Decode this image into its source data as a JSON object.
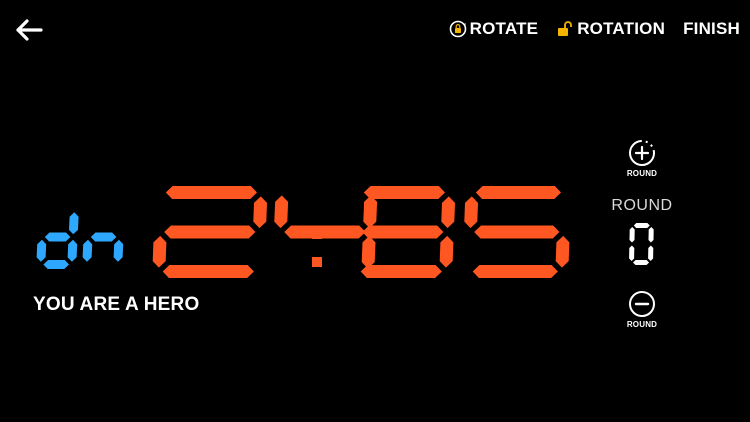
{
  "header": {
    "back_icon": "arrow-left-icon",
    "actions": [
      {
        "label": "ROTATE",
        "icon": "rotate-lock-icon"
      },
      {
        "label": "ROTATION",
        "icon": "unlock-icon"
      },
      {
        "label": "FINISH"
      }
    ],
    "icon_accent": "#f5b400"
  },
  "timer": {
    "direction": "dn",
    "minutes": "24",
    "seconds": "35",
    "separator": ":",
    "time_color": "#ff5722",
    "direction_color": "#2ea8ff"
  },
  "message": "YOU ARE A HERO",
  "round": {
    "title": "ROUND",
    "value": "0",
    "plus_label": "ROUND",
    "minus_label": "ROUND",
    "plus_icon": "plus-circle-icon",
    "minus_icon": "minus-circle-icon"
  }
}
